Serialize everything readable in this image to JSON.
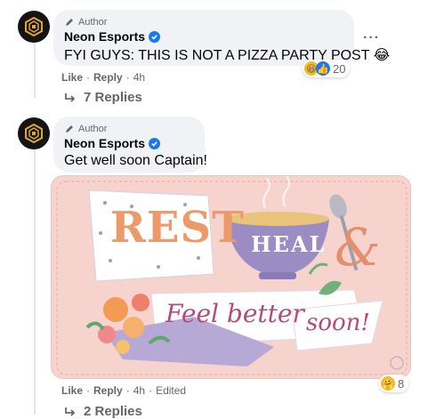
{
  "comments": [
    {
      "badge": "Author",
      "name": "Neon Esports",
      "text": "FYI GUYS: THIS IS NOT A PIZZA PARTY POST 😂",
      "reaction_count": "20",
      "actions": {
        "like": "Like",
        "sep1": "·",
        "reply": "Reply",
        "sep2": "·",
        "time": "4h"
      },
      "replies_label": "7 Replies",
      "more": "···"
    },
    {
      "badge": "Author",
      "name": "Neon Esports",
      "text": "Get well soon Captain!",
      "reaction_count": "8",
      "actions": {
        "like": "Like",
        "sep1": "·",
        "reply": "Reply",
        "sep2": "·",
        "time": "4h",
        "sep3": "·",
        "edited": "Edited"
      },
      "replies_label": "2 Replies",
      "card": {
        "word1": "REST",
        "word2": "HEAL",
        "amp": "&",
        "banner": "Feel better",
        "banner2": "soon!"
      }
    }
  ],
  "colors": {
    "verified": "#1877f2",
    "bubble": "#f0f2f5",
    "muted": "#65676b",
    "card_bg": "#f6d3cc"
  }
}
